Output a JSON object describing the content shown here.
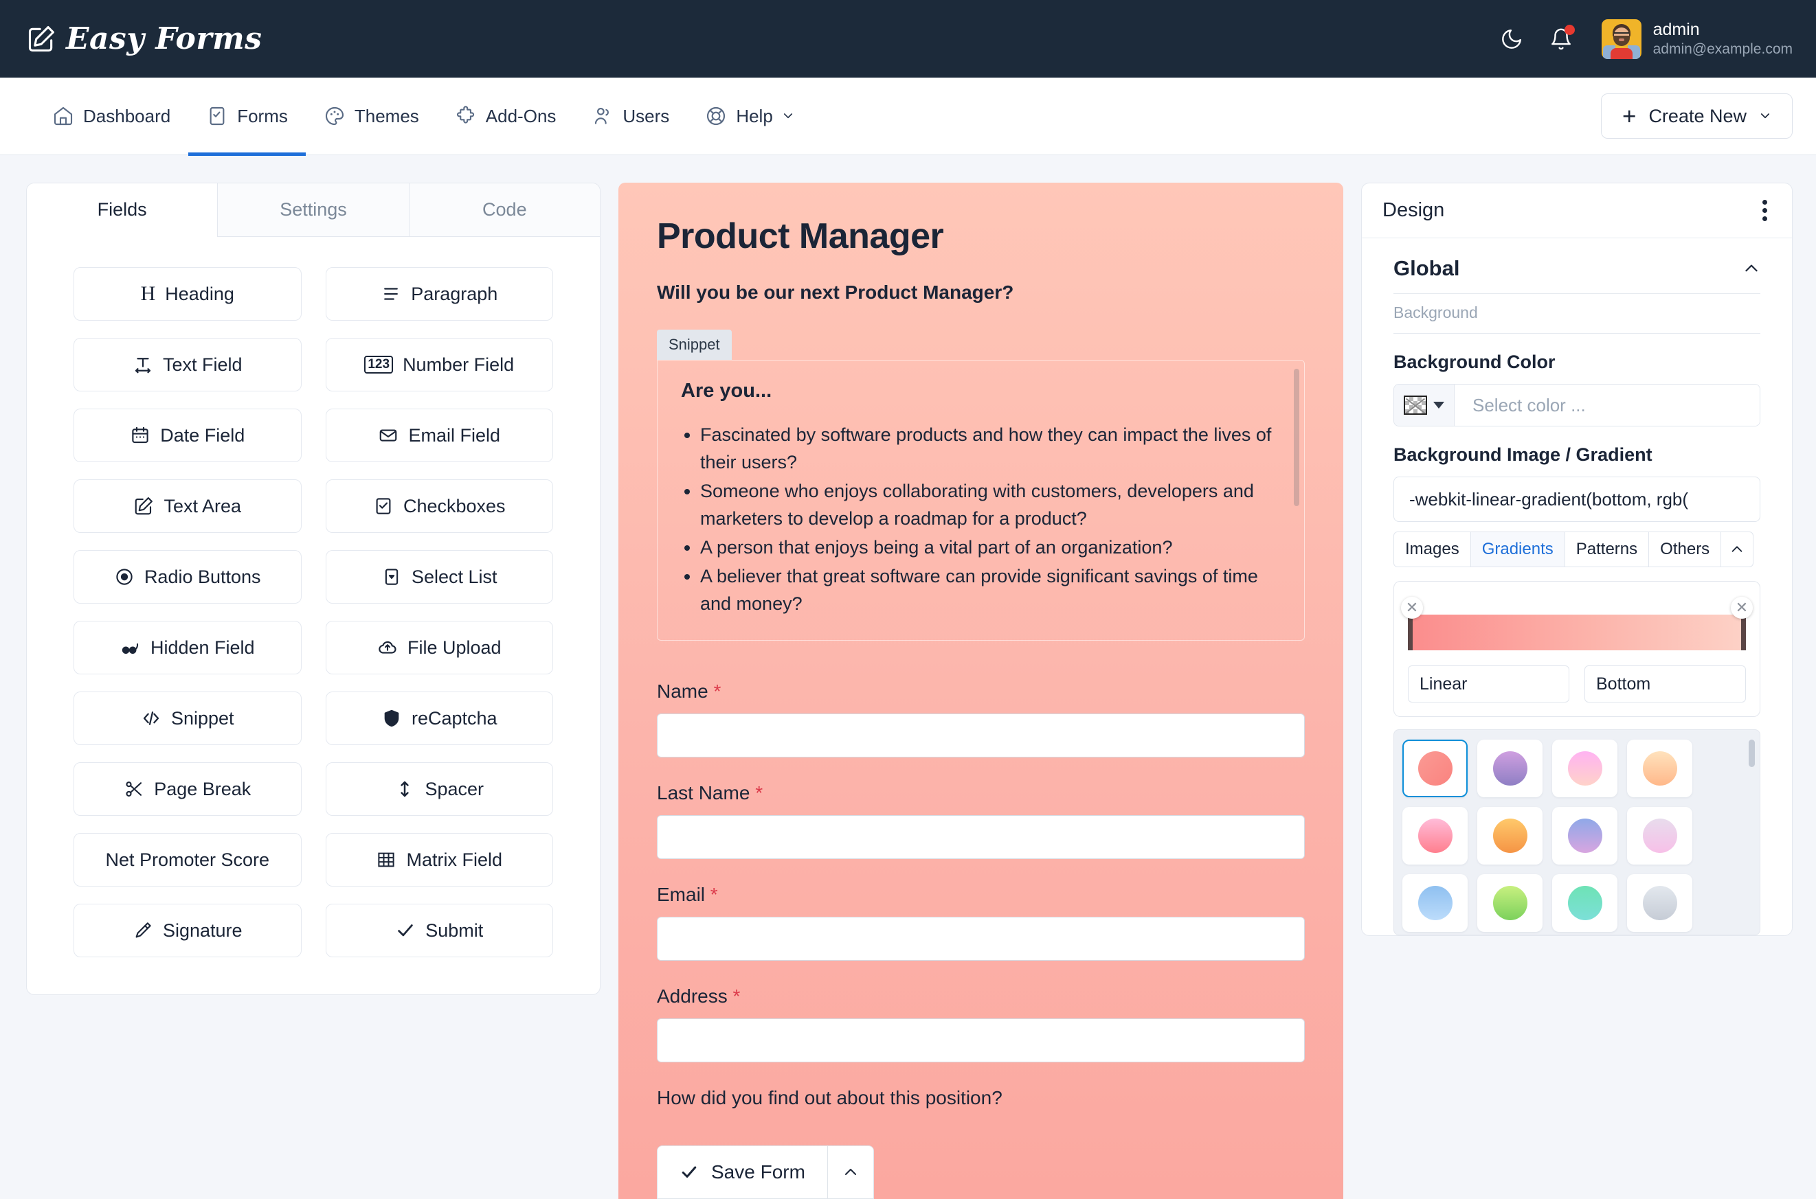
{
  "topbar": {
    "brand": "Easy Forms",
    "logo_icon": "pencil-square-icon",
    "dark_mode_icon": "moon-icon",
    "notifications_icon": "bell-icon",
    "avatar_icon": "user-avatar",
    "user_name": "admin",
    "user_email": "admin@example.com"
  },
  "nav": {
    "items": [
      {
        "label": "Dashboard",
        "icon": "home-icon",
        "active": false
      },
      {
        "label": "Forms",
        "icon": "form-check-icon",
        "active": true
      },
      {
        "label": "Themes",
        "icon": "palette-icon",
        "active": false
      },
      {
        "label": "Add-Ons",
        "icon": "puzzle-icon",
        "active": false
      },
      {
        "label": "Users",
        "icon": "users-icon",
        "active": false
      },
      {
        "label": "Help",
        "icon": "lifebuoy-icon",
        "active": false,
        "caret": true
      }
    ],
    "create_new": "Create New",
    "create_new_plus": "+"
  },
  "left_panel": {
    "tabs": [
      {
        "label": "Fields",
        "active": true
      },
      {
        "label": "Settings",
        "active": false
      },
      {
        "label": "Code",
        "active": false
      }
    ],
    "fields": [
      {
        "label": "Heading",
        "icon": "heading-icon"
      },
      {
        "label": "Paragraph",
        "icon": "paragraph-icon"
      },
      {
        "label": "Text Field",
        "icon": "text-field-icon"
      },
      {
        "label": "Number Field",
        "icon": "number-123-icon"
      },
      {
        "label": "Date Field",
        "icon": "calendar-icon"
      },
      {
        "label": "Email Field",
        "icon": "envelope-icon"
      },
      {
        "label": "Text Area",
        "icon": "pencil-square-icon"
      },
      {
        "label": "Checkboxes",
        "icon": "checkbox-icon"
      },
      {
        "label": "Radio Buttons",
        "icon": "radio-icon"
      },
      {
        "label": "Select List",
        "icon": "select-list-icon"
      },
      {
        "label": "Hidden Field",
        "icon": "glasses-icon"
      },
      {
        "label": "File Upload",
        "icon": "cloud-upload-icon"
      },
      {
        "label": "Snippet",
        "icon": "code-icon"
      },
      {
        "label": "reCaptcha",
        "icon": "shield-icon"
      },
      {
        "label": "Page Break",
        "icon": "scissors-icon"
      },
      {
        "label": "Spacer",
        "icon": "arrows-vertical-icon"
      },
      {
        "label": "Net Promoter Score",
        "icon": "none"
      },
      {
        "label": "Matrix Field",
        "icon": "grid-table-icon"
      },
      {
        "label": "Signature",
        "icon": "signature-pen-icon"
      },
      {
        "label": "Submit",
        "icon": "check-icon"
      }
    ]
  },
  "form_preview": {
    "title": "Product Manager",
    "subtitle": "Will you be our next Product Manager?",
    "snippet_tag": "Snippet",
    "snippet_heading": "Are you...",
    "snippet_items": [
      "Fascinated by software products and how they can impact the lives of their users?",
      "Someone who enjoys collaborating with customers, developers and marketers to develop a roadmap for a product?",
      "A person that enjoys being a vital part of an organization?",
      "A believer that great software can provide significant savings of time and money?"
    ],
    "fields": [
      {
        "label": "Name",
        "required": "*",
        "value": ""
      },
      {
        "label": "Last Name",
        "required": "*",
        "value": ""
      },
      {
        "label": "Email",
        "required": "*",
        "value": ""
      },
      {
        "label": "Address",
        "required": "*",
        "value": ""
      }
    ],
    "last_question": "How did you find out about this position?",
    "save_label": "Save Form",
    "save_icon": "check-icon",
    "save_caret_icon": "chevron-up-icon",
    "background_gradient_from": "#ffc7b8",
    "background_gradient_to": "#fba8a0"
  },
  "design_panel": {
    "title": "Design",
    "kebab_icon": "kebab-menu-icon",
    "section_title": "Global",
    "section_collapse_icon": "chevron-up-icon",
    "background_sub": "Background",
    "background_color_label": "Background Color",
    "background_color_placeholder": "Select color ...",
    "background_color_swatch_icon": "transparent-checker-icon",
    "background_image_label": "Background Image / Gradient",
    "gradient_value": "-webkit-linear-gradient(bottom, rgb(",
    "source_tabs": [
      {
        "label": "Images",
        "active": false
      },
      {
        "label": "Gradients",
        "active": true
      },
      {
        "label": "Patterns",
        "active": false
      },
      {
        "label": "Others",
        "active": false
      }
    ],
    "source_tabs_collapse_icon": "chevron-up-icon",
    "gradient_strip_from": "#fb8c8c",
    "gradient_strip_to": "#fdd2c7",
    "gradient_type": "Linear",
    "gradient_direction": "Bottom",
    "stop_remove_icon": "close-icon",
    "swatches": [
      {
        "from": "#fb9a94",
        "to": "#f9837f",
        "selected": true
      },
      {
        "from": "#cf9fe0",
        "to": "#8f7fc4",
        "selected": false
      },
      {
        "from": "#ffb3f2",
        "to": "#ffd2c9",
        "selected": false
      },
      {
        "from": "#ffe2bd",
        "to": "#ffb88a",
        "selected": false
      },
      {
        "from": "#ffbcd9",
        "to": "#ff7f8e",
        "selected": false
      },
      {
        "from": "#ffc96b",
        "to": "#f59445",
        "selected": false
      },
      {
        "from": "#8fa8e8",
        "to": "#d8a6e0",
        "selected": false
      },
      {
        "from": "#e8dced",
        "to": "#f7c0e8",
        "selected": false
      },
      {
        "from": "#8fc0f0",
        "to": "#bcdcfb",
        "selected": false
      },
      {
        "from": "#c8f080",
        "to": "#7cd15c",
        "selected": false
      },
      {
        "from": "#6ee2b5",
        "to": "#7ce0d8",
        "selected": false
      },
      {
        "from": "#e3e8ee",
        "to": "#c6ccd6",
        "selected": false
      },
      {
        "from": "#8f9fe0",
        "to": "#e06fa0",
        "selected": false
      },
      {
        "from": "#ffc08a",
        "to": "#e05fc8",
        "selected": false
      },
      {
        "from": "#b6a8f7",
        "to": "#7fb0f5",
        "selected": false
      },
      {
        "from": "#f54fb8",
        "to": "#ef3f6a",
        "selected": false
      }
    ]
  }
}
